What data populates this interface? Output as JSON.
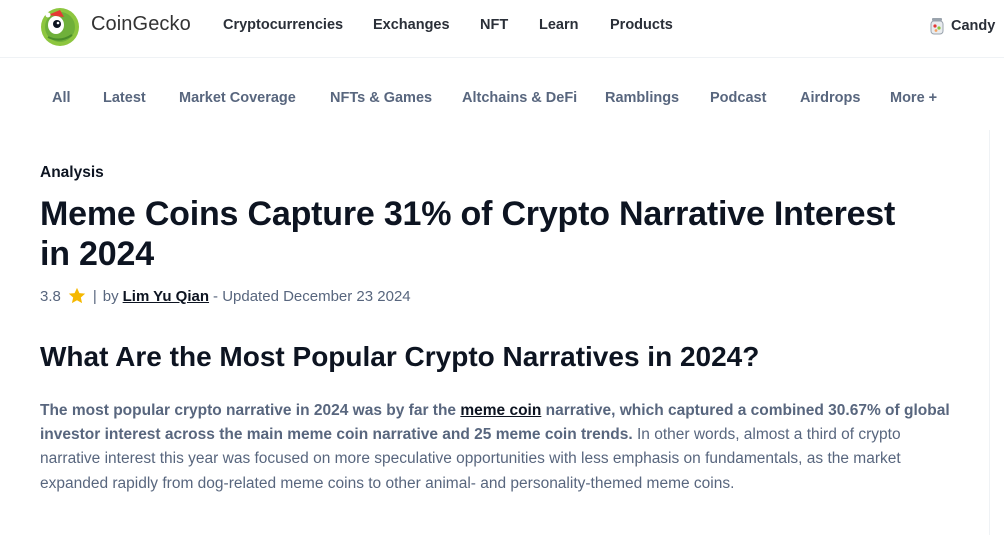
{
  "header": {
    "brand": "CoinGecko",
    "nav": [
      "Cryptocurrencies",
      "Exchanges",
      "NFT",
      "Learn",
      "Products"
    ],
    "candy_label": "Candy"
  },
  "categories": [
    "All",
    "Latest",
    "Market Coverage",
    "NFTs & Games",
    "Altchains & DeFi",
    "Ramblings",
    "Podcast",
    "Airdrops",
    "More +"
  ],
  "article": {
    "kicker": "Analysis",
    "title": "Meme Coins Capture 31% of Crypto Narrative Interest in 2024",
    "rating": "3.8",
    "sep": "|",
    "by": "by",
    "author": "Lim Yu Qian",
    "updated": "- Updated December 23 2024",
    "h2": "What Are the Most Popular Crypto Narratives in 2024?",
    "para": {
      "bold_a": "The most popular crypto narrative in 2024 was by far the ",
      "link": "meme coin",
      "bold_b": " narrative, which captured a combined 30.67% of global investor interest across the main meme coin narrative and 25 meme coin trends.",
      "rest": " In other words, almost a third of crypto narrative interest this year was focused on more speculative opportunities with less emphasis on fundamentals, as the market expanded rapidly from dog-related meme coins to other animal- and personality-themed meme coins."
    }
  },
  "colors": {
    "text_primary": "#0d1421",
    "text_secondary": "#58667e",
    "brand_green": "#8dc63f",
    "star": "#f6b87e"
  },
  "icons": [
    "coingecko-logo",
    "candy-icon",
    "star-icon"
  ]
}
